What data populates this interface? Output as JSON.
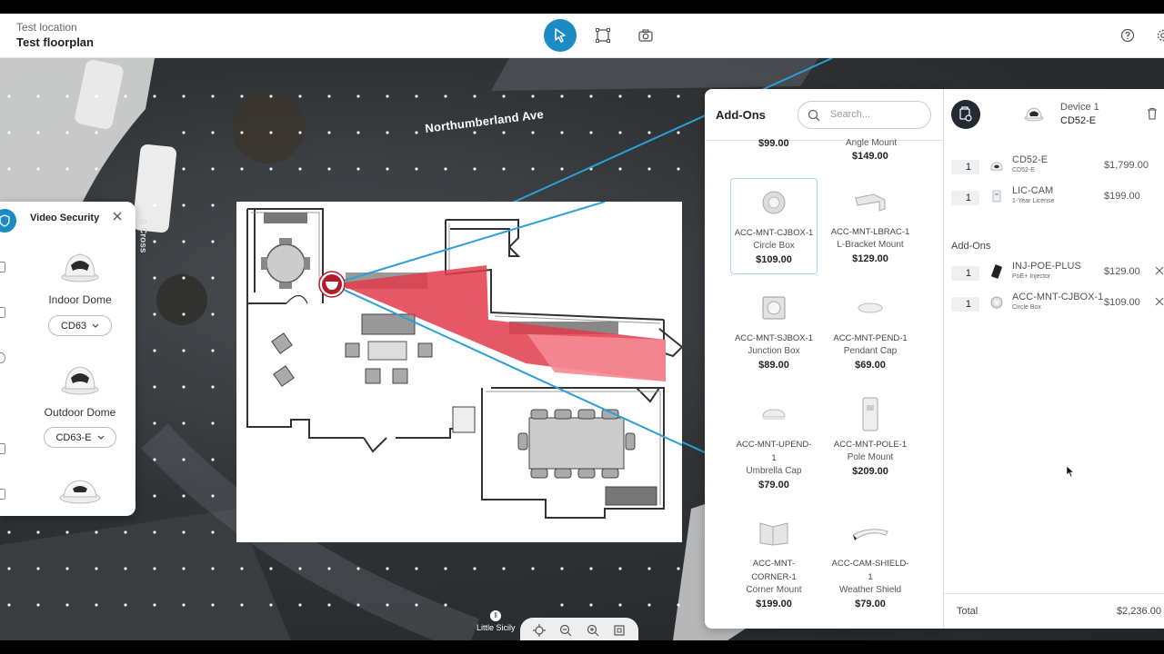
{
  "header": {
    "location": "Test location",
    "floorplan": "Test floorplan",
    "tools": [
      "select-tool",
      "area-tool",
      "camera-tool"
    ],
    "help_icon": "help-icon"
  },
  "map": {
    "street_label": "Northumberland Ave",
    "side_street_label": "S Cross",
    "poi_label": "Little Sicily"
  },
  "video_panel": {
    "title": "Video Security",
    "items": [
      {
        "label": "Indoor Dome",
        "model": "CD63"
      },
      {
        "label": "Outdoor Dome",
        "model": "CD63-E"
      }
    ]
  },
  "addons_panel": {
    "title": "Add-Ons",
    "search_placeholder": "Search...",
    "partial_top": {
      "left_price": "$99.00",
      "right_name": "Angle Mount",
      "right_price": "$149.00"
    },
    "products": [
      {
        "sku": "ACC-MNT-CJBOX-1",
        "name": "Circle Box",
        "price": "$109.00",
        "selected": true
      },
      {
        "sku": "ACC-MNT-LBRAC-1",
        "name": "L-Bracket Mount",
        "price": "$129.00"
      },
      {
        "sku": "ACC-MNT-SJBOX-1",
        "name": "Junction Box",
        "price": "$89.00"
      },
      {
        "sku": "ACC-MNT-PEND-1",
        "name": "Pendant Cap",
        "price": "$69.00"
      },
      {
        "sku_line1": "ACC-MNT-UPEND-",
        "sku_line2": "1",
        "name": "Umbrella Cap",
        "price": "$79.00"
      },
      {
        "sku": "ACC-MNT-POLE-1",
        "name": "Pole Mount",
        "price": "$209.00"
      },
      {
        "sku_line1": "ACC-MNT-",
        "sku_line2": "CORNER-1",
        "name": "Corner Mount",
        "price": "$199.00"
      },
      {
        "sku_line1": "ACC-CAM-SHIELD-",
        "sku_line2": "1",
        "name": "Weather Shield",
        "price": "$79.00"
      }
    ]
  },
  "device_panel": {
    "device_title": "Device 1",
    "device_model": "CD52-E",
    "lines": [
      {
        "qty": "1",
        "name": "CD52-E",
        "sub": "CD52-E",
        "price": "$1,799.00"
      },
      {
        "qty": "1",
        "name": "LIC-CAM",
        "sub": "1-Year License",
        "price": "$199.00"
      }
    ],
    "addons_heading": "Add-Ons",
    "addon_lines": [
      {
        "qty": "1",
        "name": "INJ-POE-PLUS",
        "sub": "PoE+ Injector",
        "price": "$129.00"
      },
      {
        "qty": "1",
        "name": "ACC-MNT-CJBOX-1",
        "sub": "Circle Box",
        "price": "$109.00"
      }
    ],
    "total_label": "Total",
    "total_value": "$2,236.00"
  },
  "colors": {
    "accent": "#1a8bc4",
    "coverage": "#e23b4a",
    "dark_button": "#222a33"
  }
}
